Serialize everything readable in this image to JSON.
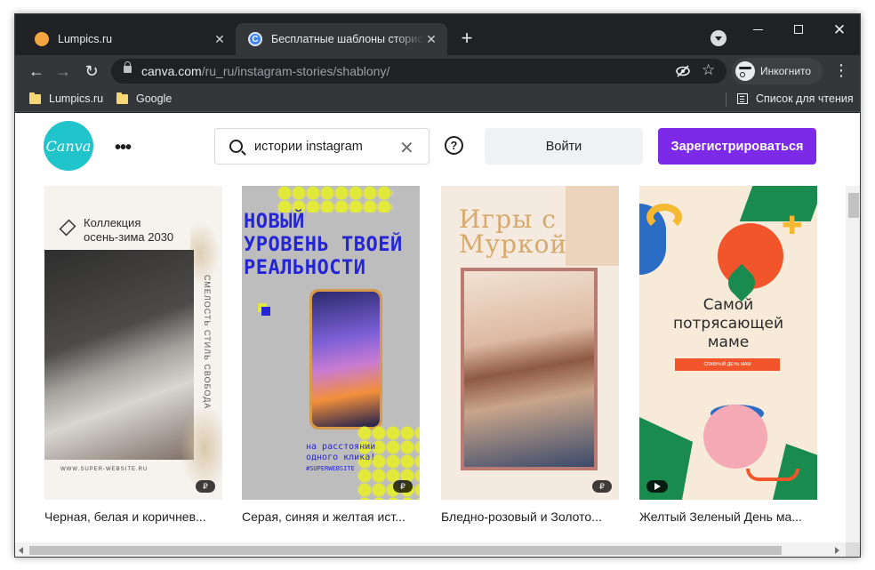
{
  "browser": {
    "tabs": [
      {
        "title": "Lumpics.ru",
        "active": false
      },
      {
        "title": "Бесплатные шаблоны сторис Instagram",
        "active": true
      }
    ],
    "new_tab": "+",
    "url_host": "canva.com",
    "url_path": "/ru_ru/instagram-stories/shablony/",
    "incognito_label": "Инкогнито",
    "bookmarks": [
      "Lumpics.ru",
      "Google"
    ],
    "reading_list": "Список для чтения"
  },
  "header": {
    "logo_text": "Canva",
    "more": "•••",
    "search_value": "истории instagram",
    "clear": "✕",
    "help": "?",
    "login": "Войти",
    "signup": "Зарегистрироваться"
  },
  "templates": [
    {
      "caption": "Черная, белая и коричнев...",
      "badge": "₽",
      "heading": "Коллекция\nосень-зима 2030",
      "vertical_text": "СМЕЛОСТЬ СТИЛЬ СВОБОДА",
      "site": "WWW.SUPER-WEBSITE.RU"
    },
    {
      "caption": "Серая, синяя и желтая ист...",
      "badge": "₽",
      "heading": "НОВЫЙ\nУРОВЕНЬ ТВОЕЙ\nРЕАЛЬНОСТИ",
      "tagline": "на расстоянии\nодного клика!",
      "hashtag": "#SUPERWEBSITE"
    },
    {
      "caption": "Бледно-розовый и Золото...",
      "badge": "₽",
      "heading": "Игры с\nМуркой"
    },
    {
      "caption": "Желтый Зеленый День ма...",
      "badge": "play",
      "heading": "Самой\nпотрясающей\nмаме",
      "bar_text": "СЛАВНЫЙ ДЕНЬ МАМ"
    }
  ],
  "colors": {
    "canva_teal": "#20c4cb",
    "signup_purple": "#7d2ae8",
    "chrome_dark": "#202124",
    "chrome_toolbar": "#35363a"
  }
}
